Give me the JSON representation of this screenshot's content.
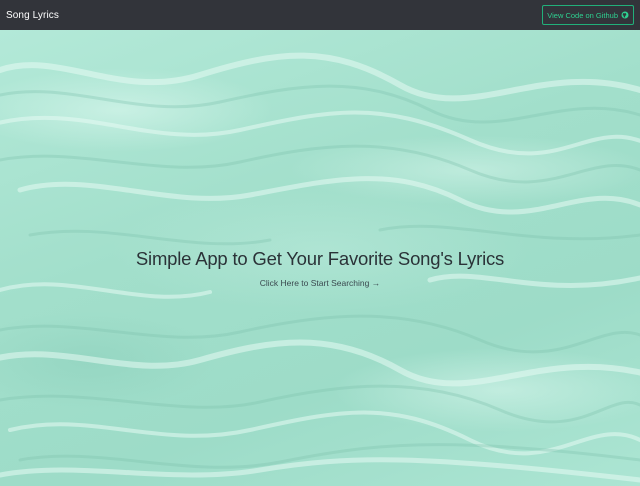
{
  "navbar": {
    "brand": "Song Lyrics",
    "github_button": "View Code on Github",
    "github_icon": "github-icon"
  },
  "hero": {
    "title": "Simple App to Get Your Favorite Song's Lyrics",
    "cta": "Click Here to Start Searching",
    "cta_icon": "arrow-right-icon"
  },
  "colors": {
    "navbar_bg": "#32343a",
    "accent": "#2ed090",
    "water": "#a6e2cf"
  }
}
